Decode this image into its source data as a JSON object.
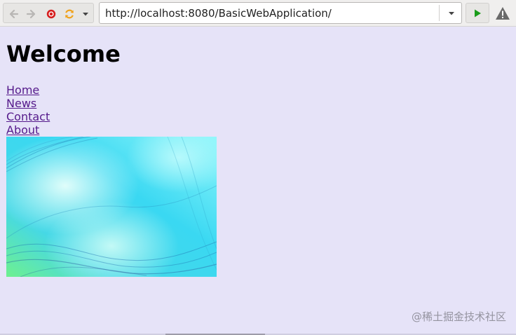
{
  "browser": {
    "url": "http://localhost:8080/BasicWebApplication/",
    "icons": {
      "back": "arrow-left-icon",
      "forward": "arrow-right-icon",
      "stop": "stop-icon",
      "reload": "reload-icon",
      "history": "chevron-down-icon",
      "url_dropdown": "chevron-down-icon",
      "go": "play-icon",
      "warning": "warning-icon"
    },
    "colors": {
      "stop": "#d61e1e",
      "reload": "#f0a21b",
      "go": "#1a9c1a",
      "warning": "#6a6a6a"
    }
  },
  "page": {
    "heading": "Welcome",
    "links": [
      "Home",
      "News",
      "Contact",
      "About"
    ],
    "background": "#e6e3f8",
    "link_color": "#551a8b"
  },
  "watermark": "@稀土掘金技术社区"
}
